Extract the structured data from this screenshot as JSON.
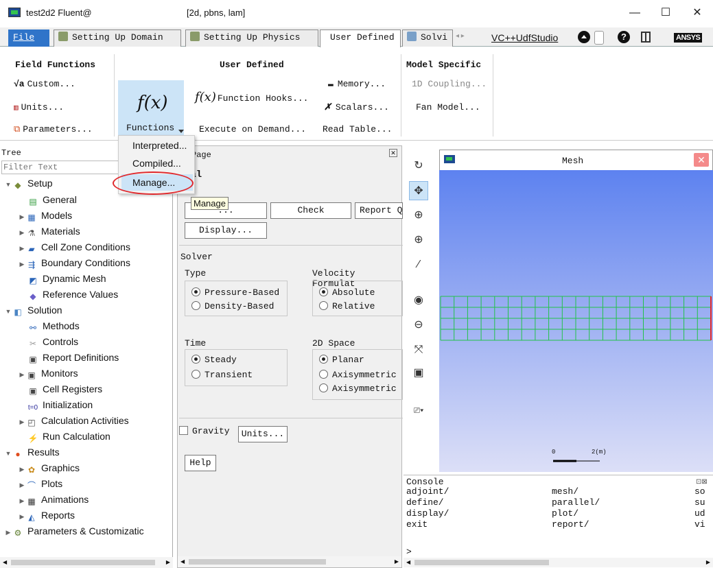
{
  "window": {
    "title": "test2d2 Fluent@",
    "subtitle": "[2d, pbns, lam]",
    "minimize_glyph": "—",
    "maximize_glyph": "☐",
    "close_glyph": "✕"
  },
  "tabs": {
    "file": "File",
    "items": [
      "Setting Up Domain",
      "Setting Up Physics",
      "User Defined",
      "Solvi"
    ],
    "arrows": "◂ ▸",
    "udf_studio": "VC++UdfStudio",
    "help_glyph": "?",
    "brand": "ANSYS"
  },
  "ribbon": {
    "field_functions": {
      "header": "Field Functions",
      "custom": "Custom...",
      "units": "Units...",
      "parameters": "Parameters..."
    },
    "user_defined": {
      "header": "User Defined",
      "functions_label": "Functions",
      "function_hooks": "Function Hooks...",
      "execute_on_demand": "Execute on Demand...",
      "memory": "Memory...",
      "scalars": "Scalars...",
      "read_table": "Read Table..."
    },
    "model_specific": {
      "header": "Model Specific",
      "coupling": "1D Coupling...",
      "fan_model": "Fan Model..."
    }
  },
  "dropdown": {
    "items": [
      "Interpreted...",
      "Compiled...",
      "Manage..."
    ],
    "tooltip": "Manage"
  },
  "tree": {
    "header": "Tree",
    "filter_placeholder": "Filter Text",
    "rows": [
      {
        "label": "Setup"
      },
      {
        "label": "General"
      },
      {
        "label": "Models"
      },
      {
        "label": "Materials"
      },
      {
        "label": "Cell Zone Conditions"
      },
      {
        "label": "Boundary Conditions"
      },
      {
        "label": "Dynamic Mesh"
      },
      {
        "label": "Reference Values"
      },
      {
        "label": "Solution"
      },
      {
        "label": "Methods"
      },
      {
        "label": "Controls"
      },
      {
        "label": "Report Definitions"
      },
      {
        "label": "Monitors"
      },
      {
        "label": "Cell Registers"
      },
      {
        "label": "Initialization"
      },
      {
        "label": "Calculation Activities"
      },
      {
        "label": "Run Calculation"
      },
      {
        "label": "Results"
      },
      {
        "label": "Graphics"
      },
      {
        "label": "Plots"
      },
      {
        "label": "Animations"
      },
      {
        "label": "Reports"
      },
      {
        "label": "Parameters & Customizatic"
      }
    ]
  },
  "task_page": {
    "title_partial": "Page",
    "heading_partial": "ral",
    "scale_btn": "...",
    "check_btn": "Check",
    "report_btn": "Report Q",
    "display_btn": "Display...",
    "solver_label": "Solver",
    "type_label": "Type",
    "pressure_based": "Pressure-Based",
    "density_based": "Density-Based",
    "velocity_label": "Velocity Formulat",
    "absolute": "Absolute",
    "relative": "Relative",
    "time_label": "Time",
    "steady": "Steady",
    "transient": "Transient",
    "space_label": "2D Space",
    "planar": "Planar",
    "axisym1": "Axisymmetric",
    "axisym2": "Axisymmetric",
    "gravity": "Gravity",
    "units_btn": "Units...",
    "help_btn": "Help"
  },
  "graphics": {
    "title": "Mesh",
    "scale_zero": "0",
    "scale_end": "2(m)"
  },
  "console": {
    "header": "Console",
    "col1": [
      "adjoint/",
      "define/",
      "display/",
      "exit"
    ],
    "col2": [
      "mesh/",
      "parallel/",
      "plot/",
      "report/"
    ],
    "col3": [
      "so",
      "su",
      "ud",
      "vi"
    ],
    "prompt": ">"
  },
  "colors": {
    "accent_blue": "#cce4f7",
    "mesh_green": "#22c24a",
    "highlight_red": "#e0282c"
  }
}
